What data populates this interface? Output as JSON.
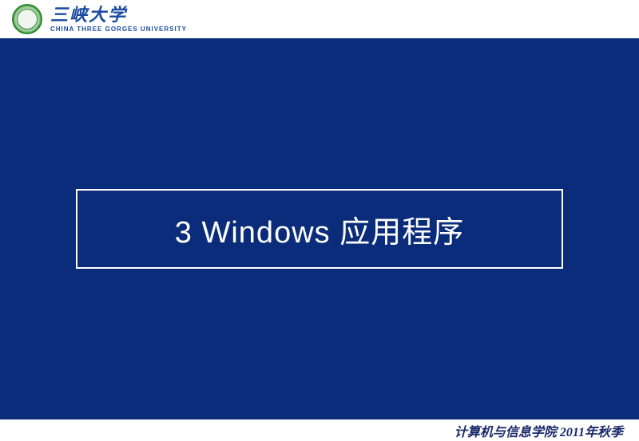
{
  "header": {
    "university_name_cn": "三峡大学",
    "university_name_en": "CHINA THREE GORGES UNIVERSITY"
  },
  "main": {
    "title": "3 Windows 应用程序"
  },
  "footer": {
    "text": "计算机与信息学院 2011年秋季"
  }
}
